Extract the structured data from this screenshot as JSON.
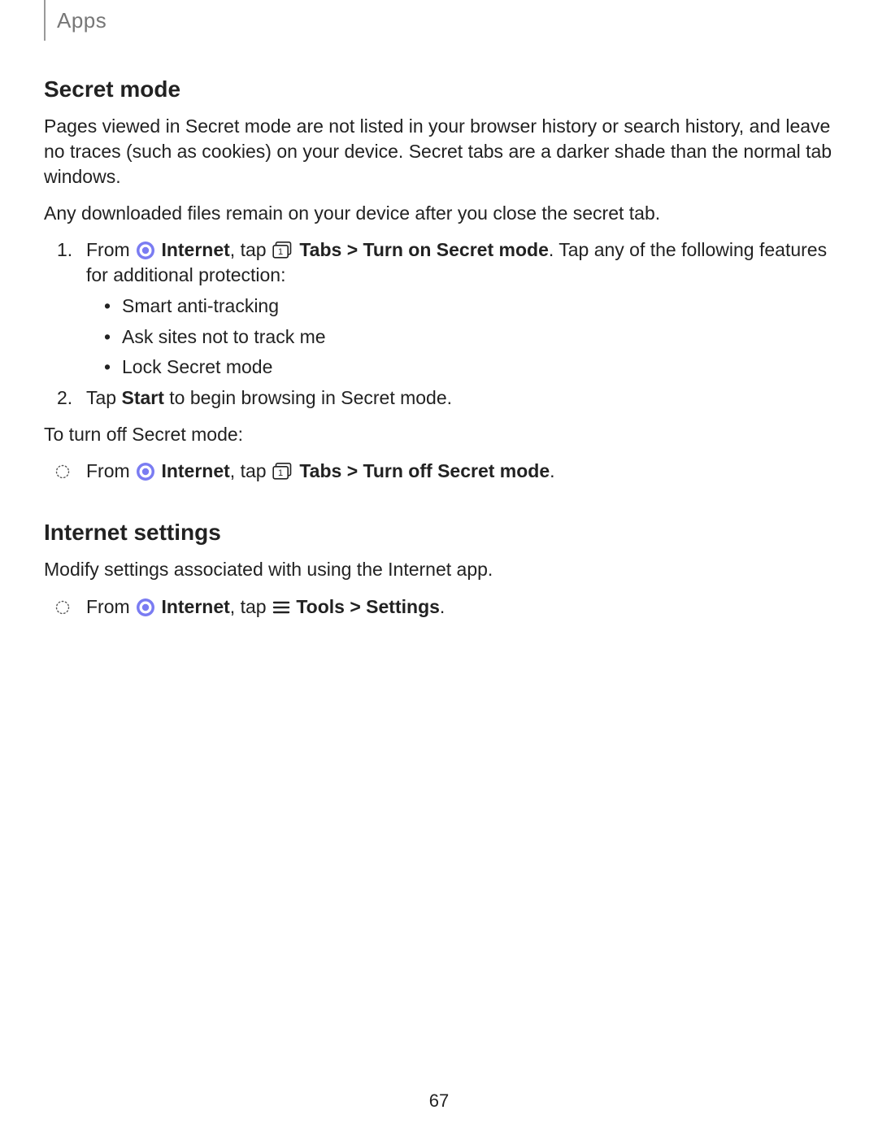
{
  "header": {
    "section_label": "Apps"
  },
  "secret_mode": {
    "heading": "Secret mode",
    "intro": "Pages viewed in Secret mode are not listed in your browser history or search history, and leave no traces (such as cookies) on your device. Secret tabs are a darker shade than the normal tab windows.",
    "note": "Any downloaded files remain on your device after you close the secret tab.",
    "step1": {
      "num": "1.",
      "t1": "From ",
      "t2_bold": "Internet",
      "t3": ", tap ",
      "t4_bold": "Tabs > Turn on Secret mode",
      "t5": ". Tap any of the following features for additional protection:"
    },
    "features": {
      "a": "Smart anti-tracking",
      "b": "Ask sites not to track me",
      "c": "Lock Secret mode"
    },
    "step2": {
      "num": "2.",
      "t1": "Tap ",
      "t2_bold": "Start",
      "t3": " to begin browsing in Secret mode."
    },
    "turn_off_intro": "To turn off Secret mode:",
    "turn_off": {
      "t1": "From ",
      "t2_bold": "Internet",
      "t3": ", tap ",
      "t4_bold": "Tabs > Turn off Secret mode",
      "t5": "."
    }
  },
  "internet_settings": {
    "heading": "Internet settings",
    "intro": "Modify settings associated with using the Internet app.",
    "step": {
      "t1": "From ",
      "t2_bold": "Internet",
      "t3": ", tap ",
      "t4_bold": "Tools > Settings",
      "t5": "."
    }
  },
  "page_number": "67",
  "tabs_icon_number": "1"
}
